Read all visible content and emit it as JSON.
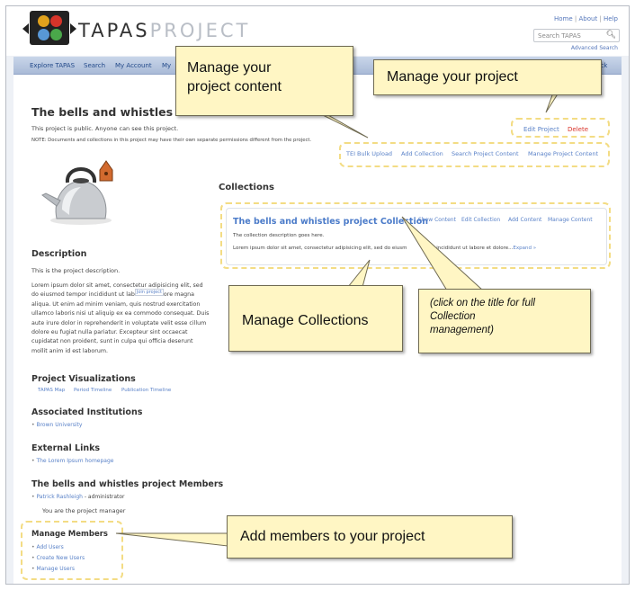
{
  "logo": {
    "title_dark": "TAPAS",
    "title_light": "PROJECT"
  },
  "toplinks": {
    "home": "Home",
    "about": "About",
    "help": "Help",
    "sep": "|"
  },
  "search": {
    "placeholder": "Search TAPAS"
  },
  "advanced_search": "Advanced Search",
  "nav": {
    "items": [
      "Explore TAPAS",
      "Search",
      "My Account",
      "My"
    ],
    "user_fragment": "trick"
  },
  "project": {
    "title": "The bells and whistles",
    "public_note": "This project is public. Anyone can see this project.",
    "perm_note": "NOTE: Documents and collections in this project may have their own separate permissions different from the project.",
    "edit_link": "Edit Project",
    "delete_link": "Delete",
    "actions": [
      "TEI Bulk Upload",
      "Add Collection",
      "Search Project Content",
      "Manage Project Content"
    ],
    "join_label": "Join project"
  },
  "description": {
    "heading": "Description",
    "intro": "This is the project description.",
    "lines": [
      "Lorem ipsum dolor sit amet, consectetur adipisicing elit, sed",
      "do eiusmod tempor incididunt ut lab",
      "ore magna",
      "aliqua. Ut enim ad minim veniam, quis nostrud exercitation",
      "ullamco laboris nisi ut aliquip ex ea commodo consequat. Duis",
      "aute irure dolor in reprehenderit in voluptate velit esse cillum",
      "dolore eu fugiat nulla pariatur. Excepteur sint occaecat",
      "cupidatat non proident, sunt in culpa qui officia deserunt",
      "mollit anim id est laborum."
    ]
  },
  "visualizations": {
    "heading": "Project Visualizations",
    "links": [
      "TAPAS Map",
      "Period Timeline",
      "Publication Timeline"
    ]
  },
  "institutions": {
    "heading": "Associated Institutions",
    "items": [
      "Brown University"
    ]
  },
  "external_links": {
    "heading": "External Links",
    "items": [
      "The Lorem Ipsum homepage"
    ]
  },
  "members": {
    "heading": "The bells and whistles project Members",
    "member_name": "Patrick Rashleigh",
    "member_role": "- administrator",
    "manager_note": "You are the project manager"
  },
  "manage_members": {
    "heading": "Manage Members",
    "links": [
      "Add Users",
      "Create New Users",
      "Manage Users"
    ]
  },
  "collections": {
    "heading": "Collections",
    "title": "The bells and whistles project Collection",
    "actions": [
      "Show Content",
      "Edit Collection",
      "Add Content",
      "Manage Content"
    ],
    "description": "The collection description goes here.",
    "lorem_left": "Lorem ipsum dolor sit amet, consectetur adipisicing elit, sed do eiusm",
    "lorem_right": "mpor incididunt ut labore et dolore...",
    "expand": "Expand »"
  },
  "callouts": {
    "manage_content": [
      "Manage your",
      "project content"
    ],
    "manage_project": "Manage your project",
    "manage_collections": "Manage Collections",
    "click_title": [
      "(click on the title for full",
      "Collection",
      "management)"
    ],
    "add_members": "Add members to your project"
  },
  "colors": {
    "link": "#5a82c8",
    "delete": "#d9332a",
    "callout_fill": "#fff6c4",
    "dash": "#f3dc84",
    "nav": "#b9c7e0"
  }
}
